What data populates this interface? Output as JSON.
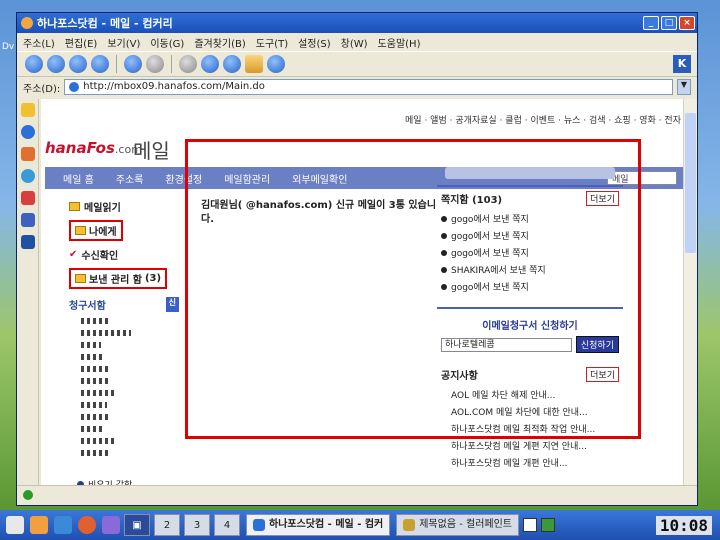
{
  "window": {
    "title": "하나포스닷컴 - 메일 - 컴커리",
    "url": "http://mbox09.hanafos.com/Main.do",
    "address_label": "주소(D):"
  },
  "menubar": [
    "주소(L)",
    "편집(E)",
    "보기(V)",
    "이동(G)",
    "즐겨찾기(B)",
    "도구(T)",
    "설정(S)",
    "창(W)",
    "도움말(H)"
  ],
  "page": {
    "topnav": "메일 · 앨범 · 공개자료실 · 클럽 · 이벤트 · 뉴스 · 검색 · 쇼핑 · 영화 · 전자",
    "logo": {
      "brand": "hanaFos",
      "com": ".com",
      "mail": "메일"
    },
    "tabs": [
      "메일 홈",
      "주소록",
      "환경설정",
      "메일함관리",
      "외부메일확인"
    ],
    "tab_search": "메일",
    "left": {
      "read_title": "메일읽기",
      "to_me": "나에게",
      "received": "수신확인",
      "inbox_label": "보낸 관리 함",
      "inbox_count": "(3)",
      "group_title": "청구서함",
      "group_tag": "신",
      "bottom": "비우기 갈함"
    },
    "welcome": "김대원님(           @hanafos.com) 신규 메일이 3통 있습니다.",
    "notes": {
      "title": "쪽지함 (103)",
      "more": "더보기",
      "items": [
        "gogo에서 보낸 쪽지",
        "gogo에서 보낸 쪽지",
        "gogo에서 보낸 쪽지",
        "SHAKIRA에서 보낸 쪽지",
        "gogo에서 보낸 쪽지"
      ]
    },
    "apply": {
      "title": "이메일청구서 신청하기",
      "select": "하나로텔레콤",
      "button": "신청하기"
    },
    "notice": {
      "title": "공지사항",
      "more": "더보기",
      "items": [
        "AOL 메일 차단 해제 안내...",
        "AOL.COM 메일 차단에 대한 안내...",
        "하나포스닷컴 메일 최적화 작업 안내...",
        "하나포스닷컴 메일 게편 지연 안내...",
        "하나포스닷컴 메일 개편 안내..."
      ]
    }
  },
  "desktop_label": "Dv",
  "taskbar": {
    "desktops": [
      "2",
      "3",
      "4"
    ],
    "apps": [
      "하나포스닷컴 - 메일 - 컴커",
      "제목없음 - 컬러페인트"
    ],
    "clock": "10:08"
  }
}
